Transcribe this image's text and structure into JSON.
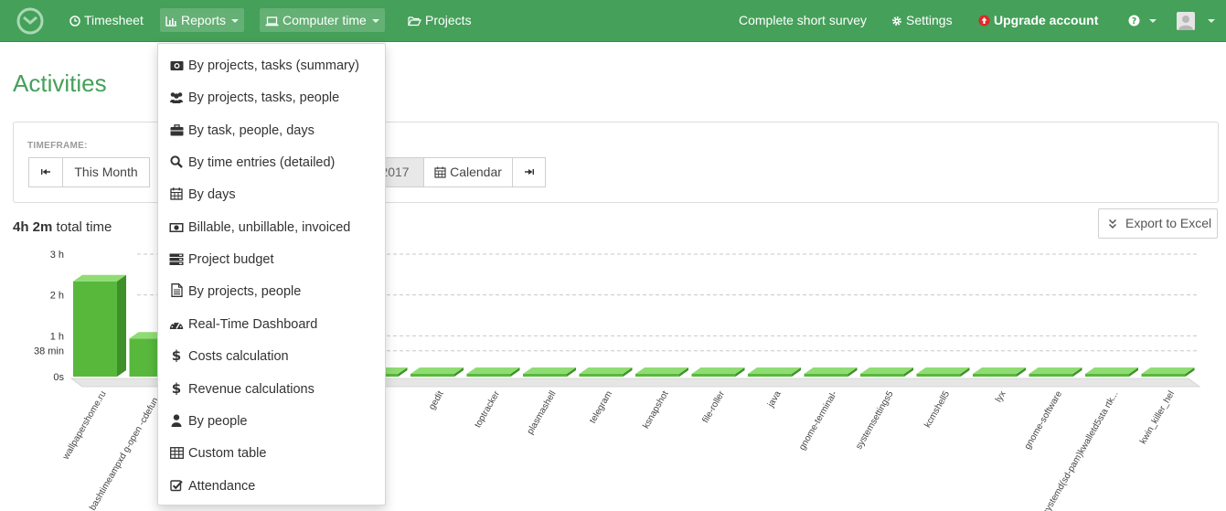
{
  "nav": {
    "timesheet": "Timesheet",
    "reports": "Reports",
    "computer_time": "Computer time",
    "projects": "Projects",
    "survey": "Complete short survey",
    "settings": "Settings",
    "upgrade": "Upgrade account"
  },
  "page": {
    "title": "Activities",
    "timeframe_label": "TIMEFRAME:",
    "this_month": "This Month",
    "date_fragment": "2017",
    "calendar": "Calendar",
    "total_strong": "4h 2m",
    "total_suffix": " total time",
    "export": "Export to Excel"
  },
  "menu": [
    {
      "label": "By projects, tasks (summary)",
      "icon": "camera-icon"
    },
    {
      "label": "By projects, tasks, people",
      "icon": "users-icon"
    },
    {
      "label": "By task, people, days",
      "icon": "briefcase-icon"
    },
    {
      "label": "By time entries (detailed)",
      "icon": "search-icon"
    },
    {
      "label": "By days",
      "icon": "calendar-icon"
    },
    {
      "label": "Billable, unbillable, invoiced",
      "icon": "money-icon"
    },
    {
      "label": "Project budget",
      "icon": "server-icon"
    },
    {
      "label": "By projects, people",
      "icon": "document-icon"
    },
    {
      "label": "Real-Time Dashboard",
      "icon": "dashboard-icon"
    },
    {
      "label": "Costs calculation",
      "icon": "dollar-icon"
    },
    {
      "label": "Revenue calculations",
      "icon": "dollar-icon"
    },
    {
      "label": "By people",
      "icon": "user-icon"
    },
    {
      "label": "Custom table",
      "icon": "table-icon"
    },
    {
      "label": "Attendance",
      "icon": "checkbox-icon"
    }
  ],
  "colors": {
    "accent": "#45a05a",
    "bar_front": "#58b83c",
    "bar_side": "#3f8f2a",
    "bar_top": "#8fdc73",
    "upgrade_icon": "#e02828"
  },
  "chart_data": {
    "type": "bar",
    "yticks": [
      "3 h",
      "2 h",
      "1 h",
      "38 min",
      "0s"
    ],
    "ytick_values_min": [
      180,
      120,
      60,
      38,
      0
    ],
    "ylim_min": [
      0,
      180
    ],
    "grid": true,
    "categories": [
      "wallpapershome.ru",
      "bashtimeampxd g-open -cdefun...",
      "",
      "",
      "",
      "",
      "gedit",
      "toptracker",
      "plasmashell",
      "telegram",
      "ksnapshot",
      "file-roller",
      "java",
      "gnome-terminal-",
      "systemsettings5",
      "kcmshell5",
      "lyx",
      "gnome-software",
      "systemd(sd-pam)kwalletd5sta rtk...",
      "kwin_killer_hel"
    ],
    "values_min": [
      140,
      56,
      1,
      1,
      1,
      1,
      1,
      1,
      1,
      1,
      1,
      1,
      1,
      1,
      1,
      1,
      1,
      1,
      1,
      1
    ]
  }
}
